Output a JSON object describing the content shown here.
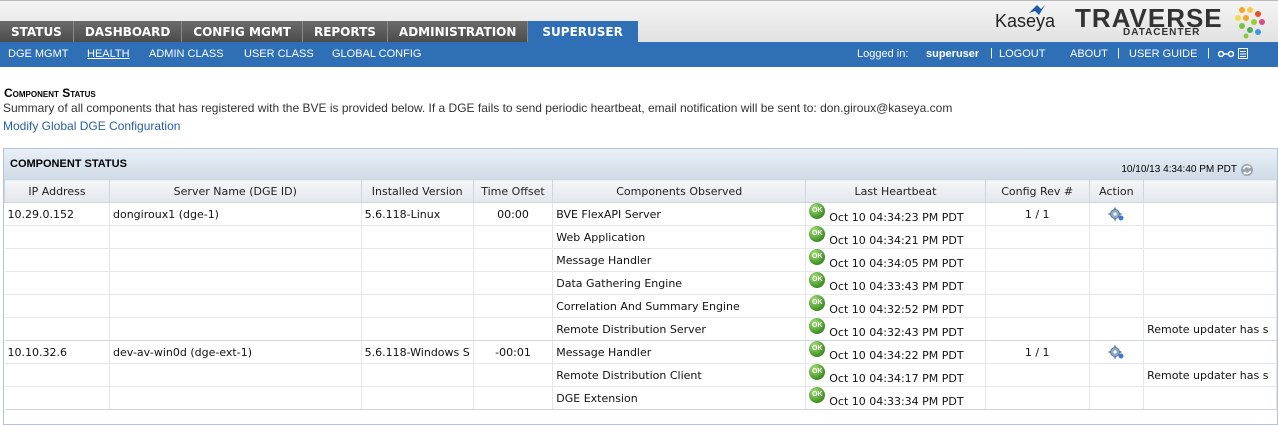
{
  "nav": {
    "tabs": [
      "STATUS",
      "DASHBOARD",
      "CONFIG MGMT",
      "REPORTS",
      "ADMINISTRATION",
      "SUPERUSER"
    ],
    "active_tab": "SUPERUSER"
  },
  "branding": {
    "kaseya": "Kaseya",
    "traverse": "TRAVERSE",
    "datacenter": "DATACENTER"
  },
  "subnav": {
    "items": [
      "DGE MGMT",
      "HEALTH",
      "ADMIN CLASS",
      "USER CLASS",
      "GLOBAL CONFIG"
    ],
    "active": "HEALTH",
    "logged_in_label": "Logged in:",
    "username": "superuser",
    "logout": "LOGOUT",
    "about": "ABOUT",
    "user_guide": "USER GUIDE"
  },
  "header": {
    "title": "Component Status",
    "description": "Summary of all components that has registered with the BVE is provided below. If a DGE fails to send periodic heartbeat, email notification will be sent to: don.giroux@kaseya.com",
    "link": "Modify Global DGE Configuration"
  },
  "panel": {
    "title": "COMPONENT STATUS",
    "timestamp": "10/10/13 4:34:40 PM PDT",
    "columns": [
      "IP Address",
      "Server Name (DGE ID)",
      "Installed Version",
      "Time Offset",
      "Components Observed",
      "Last Heartbeat",
      "Config Rev #",
      "Action",
      ""
    ],
    "rows": [
      {
        "ip": "10.29.0.152",
        "server": "dongiroux1 (dge-1)",
        "version": "5.6.118-Linux",
        "offset": "00:00",
        "component": "BVE FlexAPI Server",
        "status": "OK",
        "heartbeat": "Oct 10 04:34:23 PM PDT",
        "config_rev": "1 / 1",
        "action": true,
        "note": ""
      },
      {
        "ip": "",
        "server": "",
        "version": "",
        "offset": "",
        "component": "Web Application",
        "status": "OK",
        "heartbeat": "Oct 10 04:34:21 PM PDT",
        "config_rev": "",
        "action": false,
        "note": ""
      },
      {
        "ip": "",
        "server": "",
        "version": "",
        "offset": "",
        "component": "Message Handler",
        "status": "OK",
        "heartbeat": "Oct 10 04:34:05 PM PDT",
        "config_rev": "",
        "action": false,
        "note": ""
      },
      {
        "ip": "",
        "server": "",
        "version": "",
        "offset": "",
        "component": "Data Gathering Engine",
        "status": "OK",
        "heartbeat": "Oct 10 04:33:43 PM PDT",
        "config_rev": "",
        "action": false,
        "note": ""
      },
      {
        "ip": "",
        "server": "",
        "version": "",
        "offset": "",
        "component": "Correlation And Summary Engine",
        "status": "OK",
        "heartbeat": "Oct 10 04:32:52 PM PDT",
        "config_rev": "",
        "action": false,
        "note": ""
      },
      {
        "ip": "",
        "server": "",
        "version": "",
        "offset": "",
        "component": "Remote Distribution Server",
        "status": "OK",
        "heartbeat": "Oct 10 04:32:43 PM PDT",
        "config_rev": "",
        "action": false,
        "note": "Remote updater has s"
      },
      {
        "ip": "10.10.32.6",
        "server": "dev-av-win0d (dge-ext-1)",
        "version": "5.6.118-Windows S",
        "offset": "-00:01",
        "component": "Message Handler",
        "status": "OK",
        "heartbeat": "Oct 10 04:34:22 PM PDT",
        "config_rev": "1 / 1",
        "action": true,
        "note": ""
      },
      {
        "ip": "",
        "server": "",
        "version": "",
        "offset": "",
        "component": "Remote Distribution Client",
        "status": "OK",
        "heartbeat": "Oct 10 04:34:17 PM PDT",
        "config_rev": "",
        "action": false,
        "note": "Remote updater has s"
      },
      {
        "ip": "",
        "server": "",
        "version": "",
        "offset": "",
        "component": "DGE Extension",
        "status": "OK",
        "heartbeat": "Oct 10 04:33:34 PM PDT",
        "config_rev": "",
        "action": false,
        "note": ""
      }
    ]
  },
  "colors": {
    "nav_blue": "#2e6fb6",
    "tab_gray": "#555555",
    "link_blue": "#2a5ea8",
    "ok_green": "#3d8f22"
  }
}
